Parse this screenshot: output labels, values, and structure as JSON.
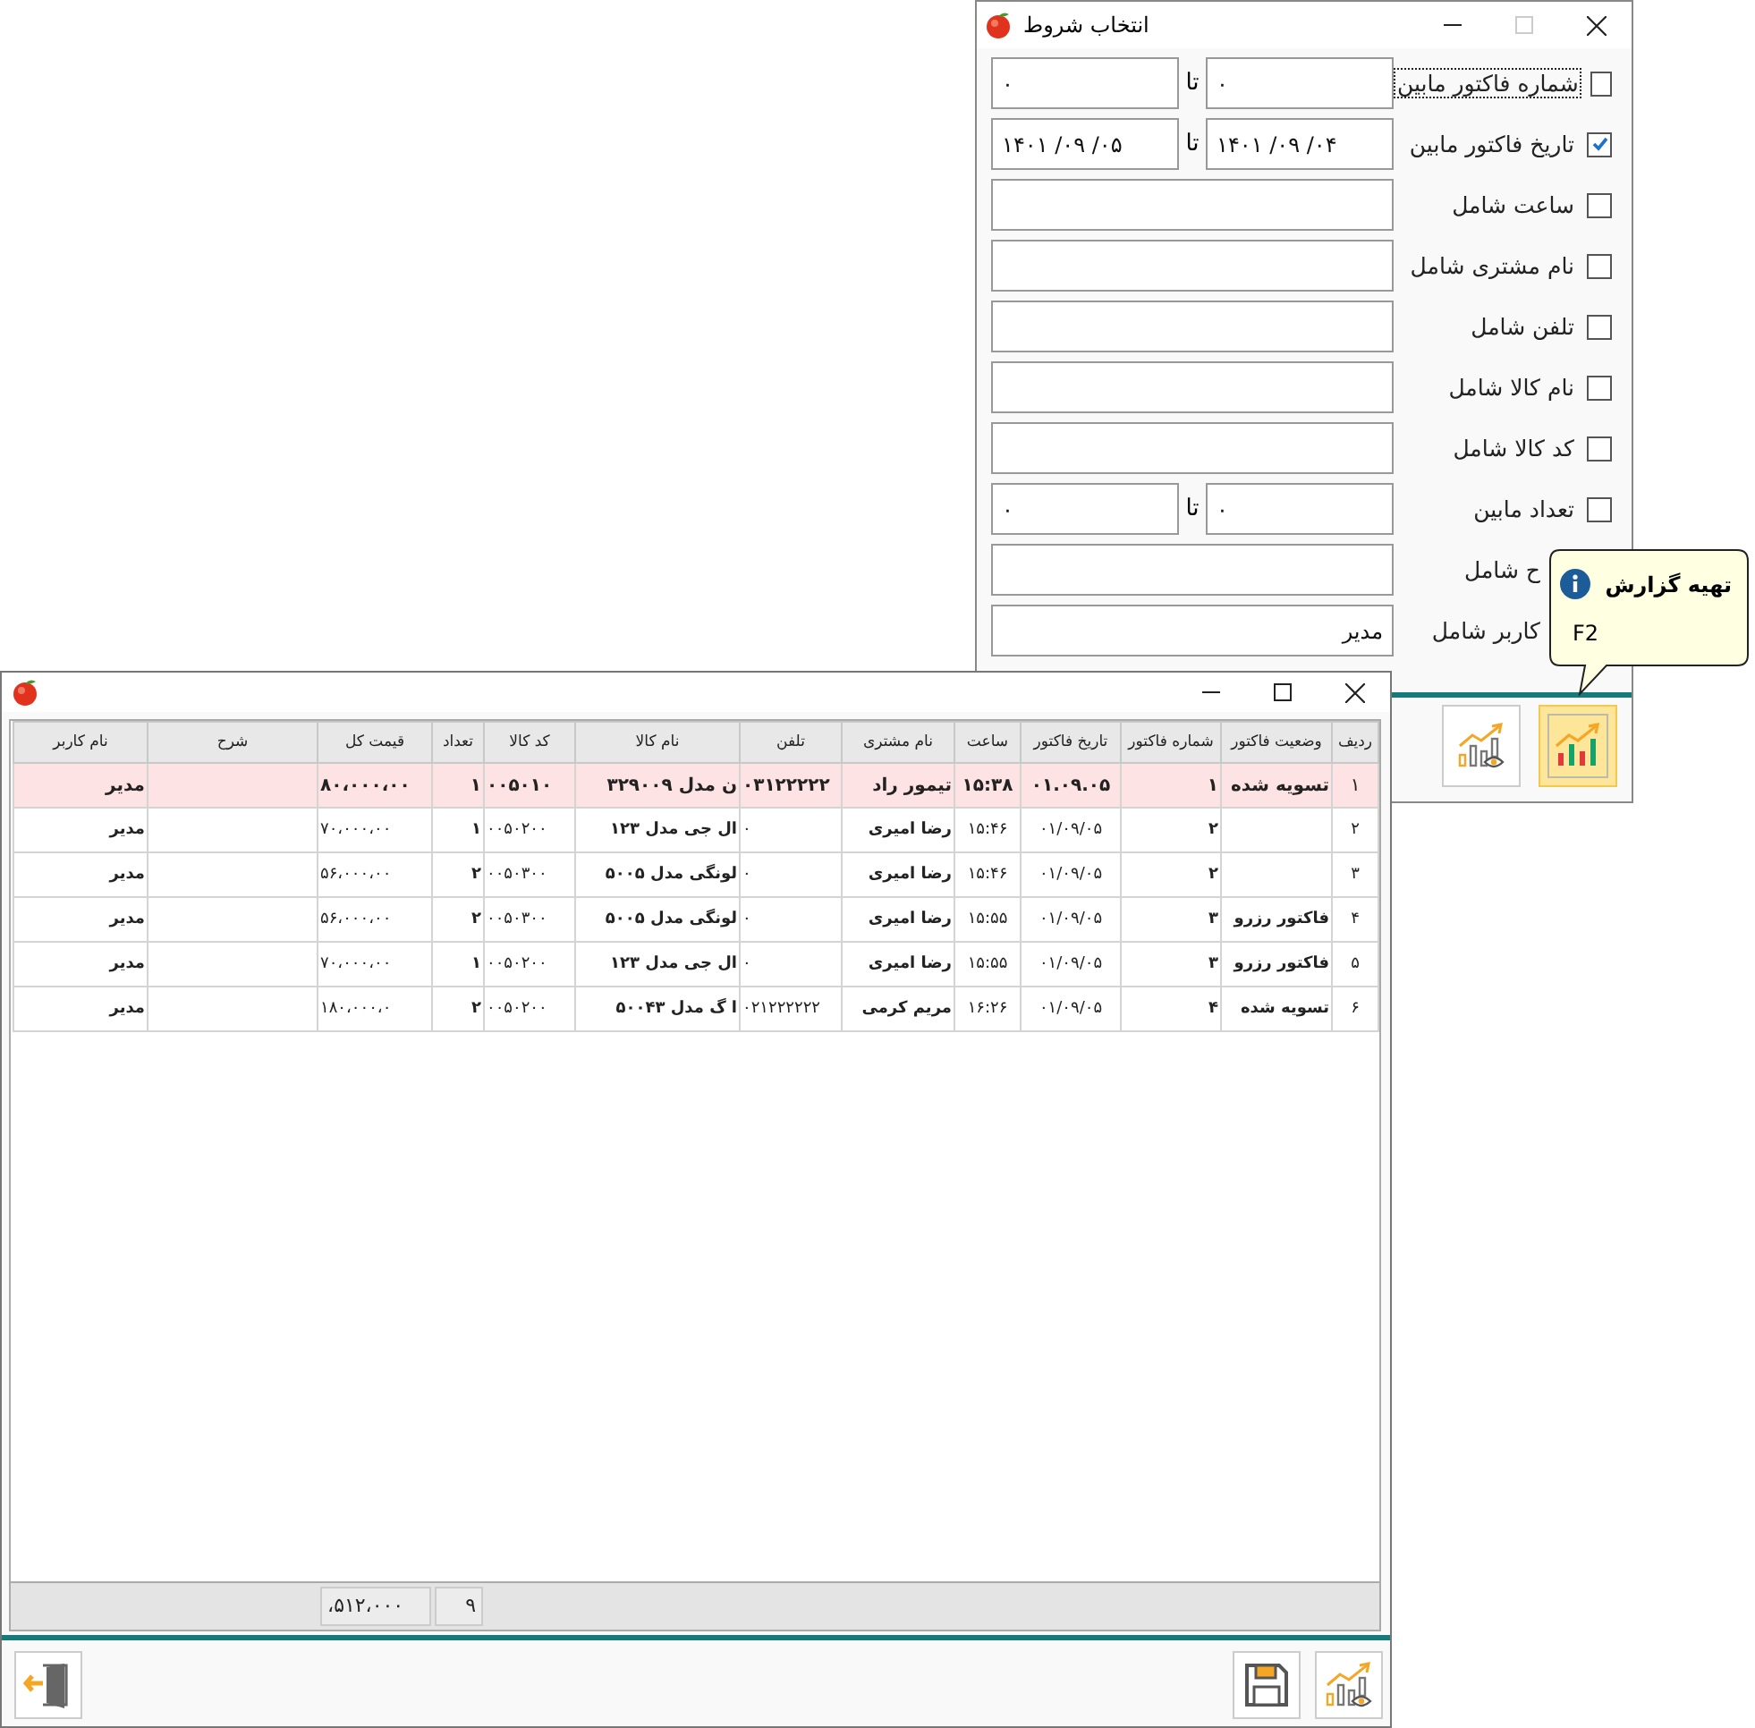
{
  "dialog": {
    "title": "انتخاب شروط",
    "maximize_enabled": false,
    "filters": [
      {
        "kind": "range",
        "label": "شماره فاکتور مابین",
        "checked": false,
        "focused": true,
        "from": "۰",
        "separator": "تا",
        "to": "۰"
      },
      {
        "kind": "range",
        "label": "تاریخ فاکتور مابین",
        "checked": true,
        "focused": false,
        "from": "۱۴۰۱ /۰۹ /۰۴",
        "separator": "تا",
        "to": "۱۴۰۱ /۰۹ /۰۵"
      },
      {
        "kind": "text",
        "label": "ساعت شامل",
        "checked": false,
        "focused": false
      },
      {
        "kind": "text",
        "label": "نام مشتری شامل",
        "checked": false,
        "focused": false
      },
      {
        "kind": "text",
        "label": "تلفن شامل",
        "checked": false,
        "focused": false
      },
      {
        "kind": "text",
        "label": "نام کالا شامل",
        "checked": false,
        "focused": false
      },
      {
        "kind": "text",
        "label": "کد کالا شامل",
        "checked": false,
        "focused": false
      },
      {
        "kind": "range",
        "label": "تعداد مابین",
        "checked": false,
        "focused": false,
        "from": "۰",
        "separator": "تا",
        "to": "۰"
      },
      {
        "kind": "text",
        "label": "ح شامل",
        "focused": false
      },
      {
        "kind": "text",
        "label": "کاربر شامل",
        "focused": false,
        "value": "مدیر"
      }
    ],
    "buttons": [
      {
        "kind": "report",
        "selected": true
      },
      {
        "kind": "preview",
        "selected": false
      }
    ]
  },
  "tooltip": {
    "title": "تهیه گزارش",
    "shortcut": "F2"
  },
  "report_window": {
    "maximize_enabled": true,
    "columns": [
      "ردیف",
      "وضعیت فاکتور",
      "شماره فاکتور",
      "تاریخ فاکتور",
      "ساعت",
      "نام مشتری",
      "تلفن",
      "نام کالا",
      "کد کالا",
      "تعداد",
      "قیمت کل",
      "شرح",
      "نام کاربر"
    ],
    "rows": [
      {
        "selected": true,
        "row_no": "۱",
        "status": "تسویه شده",
        "invoice_no": "۱",
        "date": "۰۱.۰۹.۰۵",
        "time": "۱۵:۳۸",
        "customer": "تیمور راد",
        "phone": "۰۳۱۲۲۲۲۲",
        "product": "ن مدل ۳۲۹۰۰۹",
        "code": "۰۰۵۰۱۰",
        "quantity": "۱",
        "total_price": "۸۰،۰۰۰،۰۰",
        "user": "مدیر"
      },
      {
        "selected": false,
        "row_no": "۲",
        "invoice_no": "۲",
        "date": "۰۱/۰۹/۰۵",
        "time": "۱۵:۴۶",
        "customer": "رضا امیری",
        "phone": "۰",
        "product": "ال جی مدل ۱۲۳",
        "code": "۰۰۵۰۲۰۰",
        "quantity": "۱",
        "total_price": "۷۰،۰۰۰،۰۰",
        "user": "مدیر"
      },
      {
        "selected": false,
        "row_no": "۳",
        "invoice_no": "۲",
        "date": "۰۱/۰۹/۰۵",
        "time": "۱۵:۴۶",
        "customer": "رضا امیری",
        "phone": "۰",
        "product": "لونگی مدل ۵۰۰۵",
        "code": "۰۰۵۰۳۰۰",
        "quantity": "۲",
        "total_price": "۵۶،۰۰۰،۰۰",
        "user": "مدیر"
      },
      {
        "selected": false,
        "row_no": "۴",
        "status": "فاکتور رزرو",
        "invoice_no": "۳",
        "date": "۰۱/۰۹/۰۵",
        "time": "۱۵:۵۵",
        "customer": "رضا امیری",
        "phone": "۰",
        "product": "لونگی مدل ۵۰۰۵",
        "code": "۰۰۵۰۳۰۰",
        "quantity": "۲",
        "total_price": "۵۶،۰۰۰،۰۰",
        "user": "مدیر"
      },
      {
        "selected": false,
        "row_no": "۵",
        "status": "فاکتور رزرو",
        "invoice_no": "۳",
        "date": "۰۱/۰۹/۰۵",
        "time": "۱۵:۵۵",
        "customer": "رضا امیری",
        "phone": "۰",
        "product": "ال جی مدل ۱۲۳",
        "code": "۰۰۵۰۲۰۰",
        "quantity": "۱",
        "total_price": "۷۰،۰۰۰،۰۰",
        "user": "مدیر"
      },
      {
        "selected": false,
        "row_no": "۶",
        "status": "تسویه شده",
        "invoice_no": "۴",
        "date": "۰۱/۰۹/۰۵",
        "time": "۱۶:۲۶",
        "customer": "مریم کرمی",
        "phone": "۰۲۱۲۲۲۲۲۲",
        "product": "ا گ مدل ۵۰۰۴۳",
        "code": "۰۰۵۰۲۰۰",
        "quantity": "۲",
        "total_price": "۱۸۰،۰۰۰،۰",
        "user": "مدیر"
      }
    ],
    "totals": {
      "quantity": "۹",
      "total_price": "۵۱۲،۰۰۰،"
    },
    "buttons": [
      {
        "kind": "exit"
      },
      {
        "kind": "save"
      },
      {
        "kind": "preview"
      }
    ]
  }
}
